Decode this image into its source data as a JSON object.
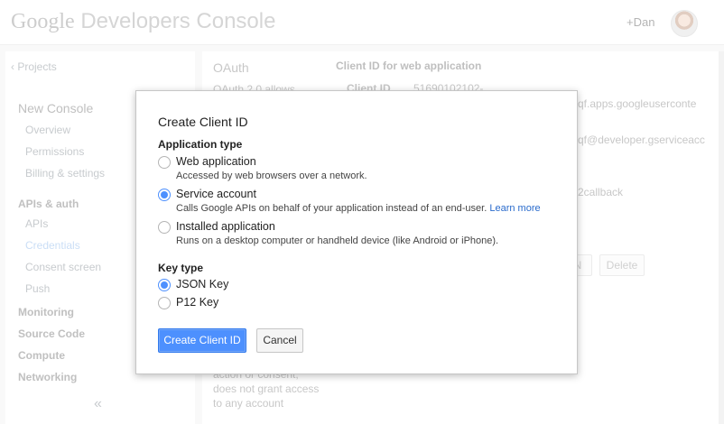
{
  "header": {
    "logo_google": "Google",
    "logo_rest": "Developers Console",
    "user": "+Dan"
  },
  "sidebar": {
    "back": "Projects",
    "project": "New Console",
    "items": [
      {
        "label": "Overview"
      },
      {
        "label": "Permissions"
      },
      {
        "label": "Billing & settings"
      },
      {
        "label": "APIs & auth"
      },
      {
        "label": "APIs"
      },
      {
        "label": "Credentials"
      },
      {
        "label": "Consent screen"
      },
      {
        "label": "Push"
      },
      {
        "label": "Monitoring"
      },
      {
        "label": "Source Code"
      },
      {
        "label": "Compute"
      },
      {
        "label": "Networking"
      }
    ],
    "collapse": "«"
  },
  "background": {
    "oauth_title": "OAuth",
    "oauth_desc": "OAuth 2.0 allows",
    "client_heading": "Client ID for web application",
    "client_id_label": "Client ID",
    "client_id_value": "51690102102-",
    "frag1": "qf.apps.googleuserconte",
    "frag2": "qf@developer.gserviceacc",
    "frag3": "2callback",
    "btn_frag": "N",
    "delete_label": "Delete",
    "bottom1": "action or consent,",
    "bottom2": "does not grant access",
    "bottom3": "to any account"
  },
  "dialog": {
    "title": "Create Client ID",
    "app_type_label": "Application type",
    "app_types": [
      {
        "label": "Web application",
        "desc": "Accessed by web browsers over a network.",
        "checked": false
      },
      {
        "label": "Service account",
        "desc": "Calls Google APIs on behalf of your application instead of an end-user.",
        "link": "Learn more",
        "checked": true
      },
      {
        "label": "Installed application",
        "desc": "Runs on a desktop computer or handheld device (like Android or iPhone).",
        "checked": false
      }
    ],
    "key_type_label": "Key type",
    "key_types": [
      {
        "label": "JSON Key",
        "checked": true
      },
      {
        "label": "P12 Key",
        "checked": false
      }
    ],
    "create_button": "Create Client ID",
    "cancel_button": "Cancel"
  },
  "colors": {
    "accent": "#4d90fe",
    "link": "#2a6bcc",
    "active_nav": "#9fc3ee"
  }
}
